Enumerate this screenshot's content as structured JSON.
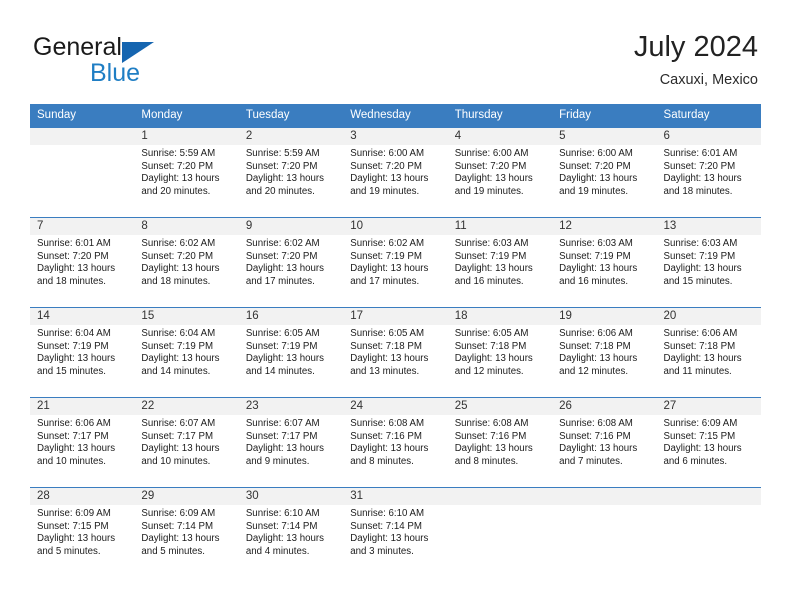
{
  "brand": {
    "name_part1": "General",
    "name_part2": "Blue",
    "triangle_color": "#1565b0",
    "blue_color": "#1f7ec4"
  },
  "header": {
    "title": "July 2024",
    "location": "Caxuxi, Mexico"
  },
  "theme": {
    "header_blue": "#3a7dc0",
    "daynum_band": "#f2f2f2",
    "text": "#1c1c1c"
  },
  "weekdays": [
    "Sunday",
    "Monday",
    "Tuesday",
    "Wednesday",
    "Thursday",
    "Friday",
    "Saturday"
  ],
  "labels": {
    "sunrise_prefix": "Sunrise:",
    "sunset_prefix": "Sunset:",
    "daylight_prefix": "Daylight:"
  },
  "weeks": [
    [
      {
        "day": "",
        "l1": "",
        "l2": "",
        "l3": "",
        "l4": ""
      },
      {
        "day": "1",
        "l1": "Sunrise: 5:59 AM",
        "l2": "Sunset: 7:20 PM",
        "l3": "Daylight: 13 hours",
        "l4": "and 20 minutes."
      },
      {
        "day": "2",
        "l1": "Sunrise: 5:59 AM",
        "l2": "Sunset: 7:20 PM",
        "l3": "Daylight: 13 hours",
        "l4": "and 20 minutes."
      },
      {
        "day": "3",
        "l1": "Sunrise: 6:00 AM",
        "l2": "Sunset: 7:20 PM",
        "l3": "Daylight: 13 hours",
        "l4": "and 19 minutes."
      },
      {
        "day": "4",
        "l1": "Sunrise: 6:00 AM",
        "l2": "Sunset: 7:20 PM",
        "l3": "Daylight: 13 hours",
        "l4": "and 19 minutes."
      },
      {
        "day": "5",
        "l1": "Sunrise: 6:00 AM",
        "l2": "Sunset: 7:20 PM",
        "l3": "Daylight: 13 hours",
        "l4": "and 19 minutes."
      },
      {
        "day": "6",
        "l1": "Sunrise: 6:01 AM",
        "l2": "Sunset: 7:20 PM",
        "l3": "Daylight: 13 hours",
        "l4": "and 18 minutes."
      }
    ],
    [
      {
        "day": "7",
        "l1": "Sunrise: 6:01 AM",
        "l2": "Sunset: 7:20 PM",
        "l3": "Daylight: 13 hours",
        "l4": "and 18 minutes."
      },
      {
        "day": "8",
        "l1": "Sunrise: 6:02 AM",
        "l2": "Sunset: 7:20 PM",
        "l3": "Daylight: 13 hours",
        "l4": "and 18 minutes."
      },
      {
        "day": "9",
        "l1": "Sunrise: 6:02 AM",
        "l2": "Sunset: 7:20 PM",
        "l3": "Daylight: 13 hours",
        "l4": "and 17 minutes."
      },
      {
        "day": "10",
        "l1": "Sunrise: 6:02 AM",
        "l2": "Sunset: 7:19 PM",
        "l3": "Daylight: 13 hours",
        "l4": "and 17 minutes."
      },
      {
        "day": "11",
        "l1": "Sunrise: 6:03 AM",
        "l2": "Sunset: 7:19 PM",
        "l3": "Daylight: 13 hours",
        "l4": "and 16 minutes."
      },
      {
        "day": "12",
        "l1": "Sunrise: 6:03 AM",
        "l2": "Sunset: 7:19 PM",
        "l3": "Daylight: 13 hours",
        "l4": "and 16 minutes."
      },
      {
        "day": "13",
        "l1": "Sunrise: 6:03 AM",
        "l2": "Sunset: 7:19 PM",
        "l3": "Daylight: 13 hours",
        "l4": "and 15 minutes."
      }
    ],
    [
      {
        "day": "14",
        "l1": "Sunrise: 6:04 AM",
        "l2": "Sunset: 7:19 PM",
        "l3": "Daylight: 13 hours",
        "l4": "and 15 minutes."
      },
      {
        "day": "15",
        "l1": "Sunrise: 6:04 AM",
        "l2": "Sunset: 7:19 PM",
        "l3": "Daylight: 13 hours",
        "l4": "and 14 minutes."
      },
      {
        "day": "16",
        "l1": "Sunrise: 6:05 AM",
        "l2": "Sunset: 7:19 PM",
        "l3": "Daylight: 13 hours",
        "l4": "and 14 minutes."
      },
      {
        "day": "17",
        "l1": "Sunrise: 6:05 AM",
        "l2": "Sunset: 7:18 PM",
        "l3": "Daylight: 13 hours",
        "l4": "and 13 minutes."
      },
      {
        "day": "18",
        "l1": "Sunrise: 6:05 AM",
        "l2": "Sunset: 7:18 PM",
        "l3": "Daylight: 13 hours",
        "l4": "and 12 minutes."
      },
      {
        "day": "19",
        "l1": "Sunrise: 6:06 AM",
        "l2": "Sunset: 7:18 PM",
        "l3": "Daylight: 13 hours",
        "l4": "and 12 minutes."
      },
      {
        "day": "20",
        "l1": "Sunrise: 6:06 AM",
        "l2": "Sunset: 7:18 PM",
        "l3": "Daylight: 13 hours",
        "l4": "and 11 minutes."
      }
    ],
    [
      {
        "day": "21",
        "l1": "Sunrise: 6:06 AM",
        "l2": "Sunset: 7:17 PM",
        "l3": "Daylight: 13 hours",
        "l4": "and 10 minutes."
      },
      {
        "day": "22",
        "l1": "Sunrise: 6:07 AM",
        "l2": "Sunset: 7:17 PM",
        "l3": "Daylight: 13 hours",
        "l4": "and 10 minutes."
      },
      {
        "day": "23",
        "l1": "Sunrise: 6:07 AM",
        "l2": "Sunset: 7:17 PM",
        "l3": "Daylight: 13 hours",
        "l4": "and 9 minutes."
      },
      {
        "day": "24",
        "l1": "Sunrise: 6:08 AM",
        "l2": "Sunset: 7:16 PM",
        "l3": "Daylight: 13 hours",
        "l4": "and 8 minutes."
      },
      {
        "day": "25",
        "l1": "Sunrise: 6:08 AM",
        "l2": "Sunset: 7:16 PM",
        "l3": "Daylight: 13 hours",
        "l4": "and 8 minutes."
      },
      {
        "day": "26",
        "l1": "Sunrise: 6:08 AM",
        "l2": "Sunset: 7:16 PM",
        "l3": "Daylight: 13 hours",
        "l4": "and 7 minutes."
      },
      {
        "day": "27",
        "l1": "Sunrise: 6:09 AM",
        "l2": "Sunset: 7:15 PM",
        "l3": "Daylight: 13 hours",
        "l4": "and 6 minutes."
      }
    ],
    [
      {
        "day": "28",
        "l1": "Sunrise: 6:09 AM",
        "l2": "Sunset: 7:15 PM",
        "l3": "Daylight: 13 hours",
        "l4": "and 5 minutes."
      },
      {
        "day": "29",
        "l1": "Sunrise: 6:09 AM",
        "l2": "Sunset: 7:14 PM",
        "l3": "Daylight: 13 hours",
        "l4": "and 5 minutes."
      },
      {
        "day": "30",
        "l1": "Sunrise: 6:10 AM",
        "l2": "Sunset: 7:14 PM",
        "l3": "Daylight: 13 hours",
        "l4": "and 4 minutes."
      },
      {
        "day": "31",
        "l1": "Sunrise: 6:10 AM",
        "l2": "Sunset: 7:14 PM",
        "l3": "Daylight: 13 hours",
        "l4": "and 3 minutes."
      },
      {
        "day": "",
        "l1": "",
        "l2": "",
        "l3": "",
        "l4": ""
      },
      {
        "day": "",
        "l1": "",
        "l2": "",
        "l3": "",
        "l4": ""
      },
      {
        "day": "",
        "l1": "",
        "l2": "",
        "l3": "",
        "l4": ""
      }
    ]
  ]
}
